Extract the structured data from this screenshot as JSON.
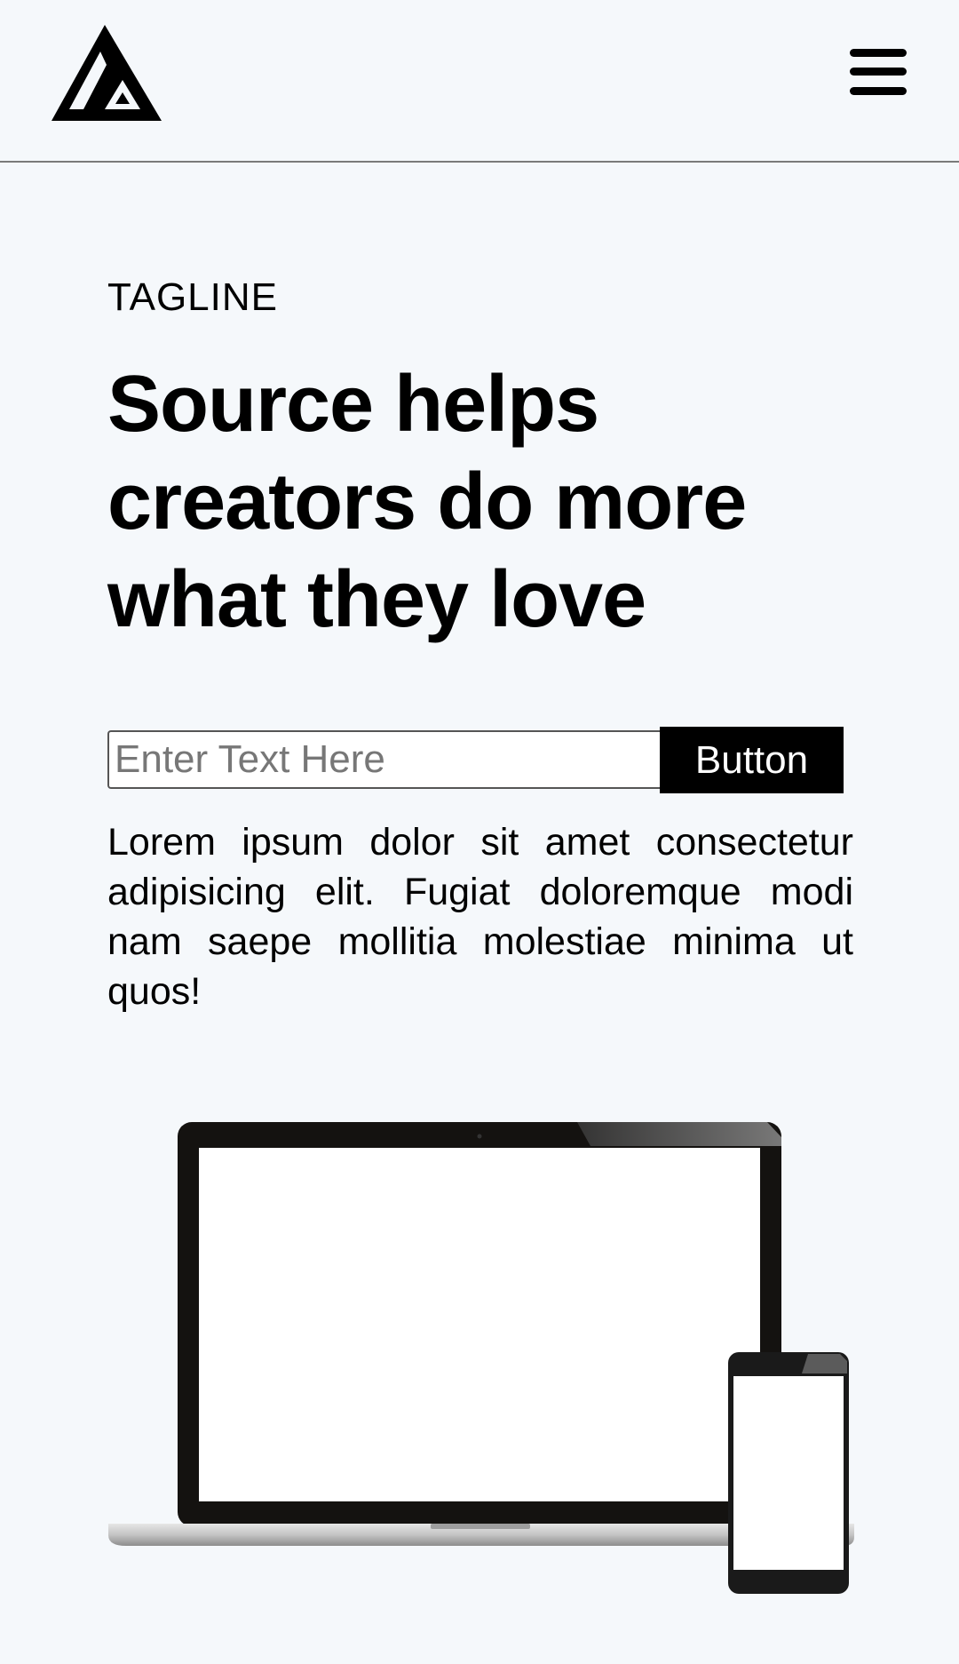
{
  "header": {
    "logo_icon": "triangle-logo-icon",
    "menu_icon": "hamburger-menu-icon"
  },
  "hero": {
    "tagline": "TAGLINE",
    "headline": "Source helps creators do more what they love",
    "input_placeholder": "Enter Text Here",
    "input_value": "",
    "button_label": "Button",
    "body": "Lorem ipsum dolor sit amet consectetur adipisicing elit. Fugiat doloremque modi nam saepe mollitia molestiae minima ut quos!"
  },
  "illustration": {
    "laptop_icon": "laptop-icon",
    "phone_icon": "smartphone-icon"
  },
  "colors": {
    "background": "#f5f8fb",
    "text": "#000000",
    "button_bg": "#000000",
    "button_text": "#ffffff"
  }
}
